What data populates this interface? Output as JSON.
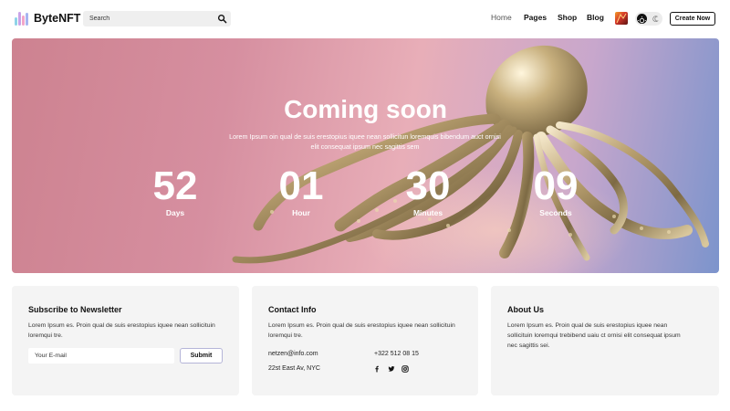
{
  "header": {
    "logo_text": "ByteNFT",
    "search": {
      "placeholder": "Search"
    },
    "nav": [
      {
        "label": "Home",
        "active": true
      },
      {
        "label": "Pages"
      },
      {
        "label": "Shop"
      },
      {
        "label": "Blog"
      }
    ],
    "create_label": "Create Now",
    "icons": [
      "search-icon",
      "nft-thumbnail",
      "theme-toggle-icon",
      "moon-icon"
    ]
  },
  "hero": {
    "title": "Coming soon",
    "subtitle": "Lorem Ipsum oin qual de suis erestopius iquee nean sollicitun loremquis bibendum auct ornisi elit consequat ipsum nec sagittis sem",
    "countdown": [
      {
        "value": "52",
        "label": "Days"
      },
      {
        "value": "01",
        "label": "Hour"
      },
      {
        "value": "30",
        "label": "Minutes"
      },
      {
        "value": "09",
        "label": "Seconds"
      }
    ]
  },
  "newsletter": {
    "title": "Subscribe to Newsletter",
    "text_lines": [
      "Lorem Ipsum es. Proin qual de suis erestopius iquee nean sollicituin",
      "loremqui tre."
    ],
    "email_placeholder": "Your E-mail",
    "submit_label": "Submit"
  },
  "contact": {
    "title": "Contact Info",
    "text_lines": [
      "Lorem Ipsum es. Proin qual de suis erestopius iquee nean sollicituin",
      "loremqui tre."
    ],
    "email": "netzen@info.com",
    "phone": "+322 512 08 15",
    "address": "22st East Av, NYC",
    "social_icons": [
      "facebook-icon",
      "twitter-icon",
      "instagram-icon"
    ]
  },
  "about": {
    "title": "About Us",
    "text_lines": [
      "Lorem Ipsum es. Proin qual de suis erestopius iquee nean",
      "sollicituin loremqui trebibend uaiu ct ornisi elit consequat ipsum",
      "nec sagittis sei."
    ]
  },
  "colors": {
    "hero_pink": "#d68fa0",
    "hero_blue": "#7c94cc",
    "card_bg": "#f4f4f4",
    "text_dark": "#111111"
  }
}
